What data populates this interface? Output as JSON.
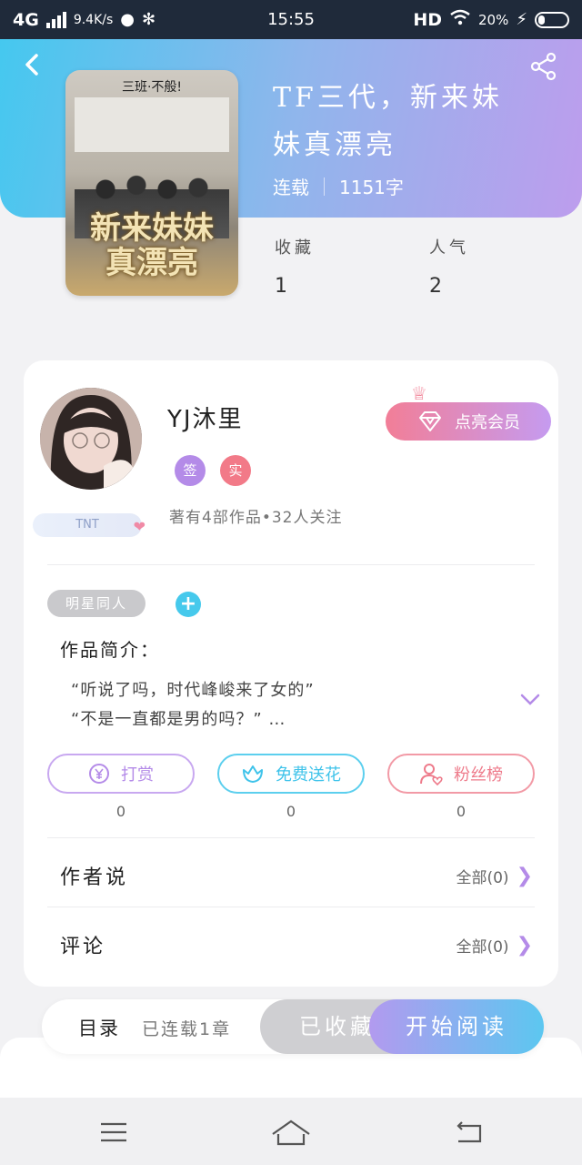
{
  "status_bar": {
    "network": "4G",
    "speed": "9.4K/s",
    "time": "15:55",
    "hd": "HD",
    "battery": "20%"
  },
  "header": {
    "book_title_line1": "TF三代，新来妹",
    "book_title_line2": "妹真漂亮",
    "status": "连载",
    "word_count": "1151字",
    "cover_top_text": "三班·不般!",
    "cover_title_line1": "新来妹妹",
    "cover_title_line2": "真漂亮",
    "stats": [
      {
        "label": "收藏",
        "value": "1"
      },
      {
        "label": "人气",
        "value": "2"
      }
    ]
  },
  "author": {
    "name": "YJ沐里",
    "tags": [
      "签",
      "实"
    ],
    "badge": "TNT",
    "stats_text": "著有4部作品•32人关注",
    "vip_button": "点亮会员"
  },
  "book_info": {
    "genre_tag": "明星同人",
    "add_tag_symbol": "+",
    "intro_title": "作品简介：",
    "intro_line1": "“听说了吗，时代峰峻来了女的”",
    "intro_line2": "“不是一直都是男的吗？” …"
  },
  "actions": [
    {
      "label": "打赏",
      "count": "0",
      "icon": "yen-coin-icon"
    },
    {
      "label": "免费送花",
      "count": "0",
      "icon": "flower-icon"
    },
    {
      "label": "粉丝榜",
      "count": "0",
      "icon": "fan-person-icon"
    }
  ],
  "sections": {
    "author_says": {
      "title": "作者说",
      "link": "全部(0)"
    },
    "comments": {
      "title": "评论",
      "link": "全部(0)"
    }
  },
  "bottom_bar": {
    "toc": "目录",
    "chapters": "已连载1章",
    "favorited": "已收藏",
    "start_reading": "开始阅读"
  },
  "colors": {
    "header_start": "#45c8ef",
    "header_end": "#bd9ded",
    "accent_purple": "#b48be8",
    "accent_cyan": "#3fc3ea",
    "accent_pink": "#ee7b8b"
  }
}
